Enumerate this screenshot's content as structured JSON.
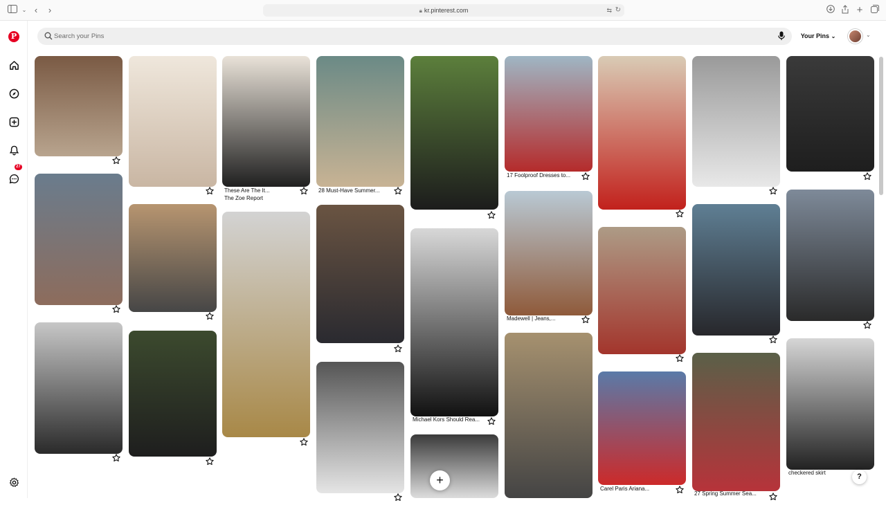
{
  "browser": {
    "url": "kr.pinterest.com"
  },
  "search": {
    "placeholder": "Search your Pins"
  },
  "header": {
    "your_pins": "Your Pins"
  },
  "rail": {
    "notifications_badge": "27"
  },
  "colors": {
    "brand": "#e60023"
  },
  "pins": [
    {
      "top": "#7a5a44",
      "bottom": "#b8a48e",
      "title": "",
      "source": ""
    },
    {
      "top": "#6a7c8d",
      "bottom": "#8d6c5c",
      "title": "",
      "source": ""
    },
    {
      "top": "#c7c7c7",
      "bottom": "#2a2a2a",
      "title": "",
      "source": ""
    },
    {
      "top": "#efe7dc",
      "bottom": "#c9b6a3",
      "title": "",
      "source": ""
    },
    {
      "top": "#b79570",
      "bottom": "#464646",
      "title": "",
      "source": ""
    },
    {
      "top": "#3c4a2e",
      "bottom": "#1e1e1e",
      "title": "",
      "source": ""
    },
    {
      "top": "#e9e2d8",
      "bottom": "#202020",
      "title": "These Are The It...",
      "source": "The Zoe Report"
    },
    {
      "top": "#d3d3d3",
      "bottom": "#a88847",
      "title": "",
      "source": ""
    },
    {
      "top": "#6b8a86",
      "bottom": "#c8b394",
      "title": "28 Must-Have Summer...",
      "source": ""
    },
    {
      "top": "#6a5442",
      "bottom": "#2a2a30",
      "title": "",
      "source": ""
    },
    {
      "top": "#555555",
      "bottom": "#e5e5e5",
      "title": "",
      "source": ""
    },
    {
      "top": "#5c7f3c",
      "bottom": "#1c1c1c",
      "title": "",
      "source": ""
    },
    {
      "top": "#d8d8d8",
      "bottom": "#111111",
      "title": "Michael Kors Should Rea...",
      "source": ""
    },
    {
      "top": "#3a3a3a",
      "bottom": "#dddddd",
      "title": "",
      "source": ""
    },
    {
      "top": "#9fb6c4",
      "bottom": "#b52b2b",
      "title": "17 Foolproof Dresses to...",
      "source": ""
    },
    {
      "top": "#b9c9d4",
      "bottom": "#8f5a3a",
      "title": "Madewell | Jeans,...",
      "source": ""
    },
    {
      "top": "#a6916f",
      "bottom": "#444444",
      "title": "",
      "source": ""
    },
    {
      "top": "#d9cbb5",
      "bottom": "#c2211c",
      "title": "",
      "source": ""
    },
    {
      "top": "#ad9b86",
      "bottom": "#a3352c",
      "title": "",
      "source": ""
    },
    {
      "top": "#5a7aa8",
      "bottom": "#cc2a2a",
      "title": "Carel Paris Ariana...",
      "source": ""
    },
    {
      "top": "#9a9a9a",
      "bottom": "#e8e8e8",
      "title": "",
      "source": ""
    },
    {
      "top": "#5f7f94",
      "bottom": "#27272b",
      "title": "",
      "source": ""
    },
    {
      "top": "#5a6048",
      "bottom": "#b7333a",
      "title": "27 Spring Summer Sea...",
      "source": ""
    },
    {
      "top": "#3a3a3a",
      "bottom": "#1e1e1e",
      "title": "",
      "source": ""
    },
    {
      "top": "#7e8a99",
      "bottom": "#2a2a2a",
      "title": "",
      "source": ""
    },
    {
      "top": "#d6d6d6",
      "bottom": "#222222",
      "title": "checkered skirt",
      "source": ""
    }
  ]
}
